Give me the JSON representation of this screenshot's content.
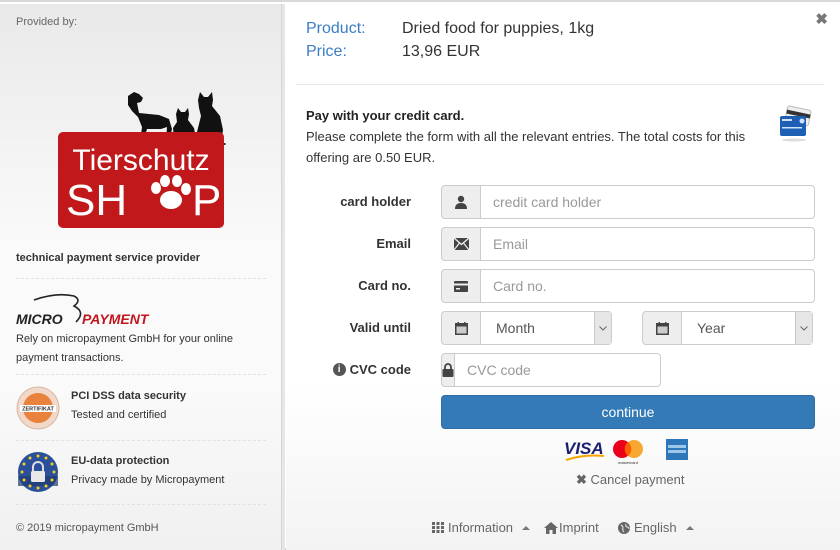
{
  "sidebar": {
    "provided_by": "Provided by:",
    "shop_logo": {
      "line1": "Tierschutz",
      "line2_left": "SH",
      "line2_right": "P",
      "color": "#c1191b"
    },
    "technical_provider": "technical payment service provider",
    "micropayment": {
      "logo_left": "MICRO",
      "logo_right": "PAYMENT",
      "text": "Rely on micropayment GmbH for your online payment transactions."
    },
    "badges": [
      {
        "title": "PCI DSS data security",
        "subtitle": "Tested and certified",
        "icon": "zertifikat-badge-icon",
        "badge_text": "ZERTIFIKAT"
      },
      {
        "title": "EU-data protection",
        "subtitle": "Privacy made by Micropayment",
        "icon": "eu-lock-badge-icon"
      }
    ],
    "copyright": "© 2019 micropayment GmbH"
  },
  "summary": {
    "product_label": "Product:",
    "product_value": "Dried food for puppies, 1kg",
    "price_label": "Price:",
    "price_value": "13,96 EUR"
  },
  "intro": {
    "title": "Pay with your credit card.",
    "description": "Please complete the form with all the relevant entries. The total costs for this offering are 0.50 EUR."
  },
  "form": {
    "card_holder": {
      "label": "card holder",
      "placeholder": "credit card holder",
      "value": "",
      "icon": "user-icon"
    },
    "email": {
      "label": "Email",
      "placeholder": "Email",
      "value": "",
      "icon": "envelope-icon"
    },
    "card_no": {
      "label": "Card no.",
      "placeholder": "Card no.",
      "value": "",
      "icon": "credit-card-icon"
    },
    "valid_until": {
      "label": "Valid until",
      "month": {
        "selected": "Month",
        "icon": "calendar-icon"
      },
      "year": {
        "selected": "Year",
        "icon": "calendar-icon"
      }
    },
    "cvc": {
      "label": "CVC code",
      "placeholder": "CVC code",
      "value": "",
      "icon": "lock-icon",
      "info_icon": "info-icon"
    },
    "continue_label": "continue",
    "accepted_cards": [
      "VISA",
      "mastercard",
      "American Express"
    ],
    "cancel_label": "Cancel payment"
  },
  "footer": {
    "information": "Information",
    "imprint": "Imprint",
    "language": "English"
  },
  "colors": {
    "accent": "#337ab7",
    "label_blue": "#3a7cc6",
    "brand_red": "#c1191b",
    "micropayment_red": "#c0161d"
  }
}
